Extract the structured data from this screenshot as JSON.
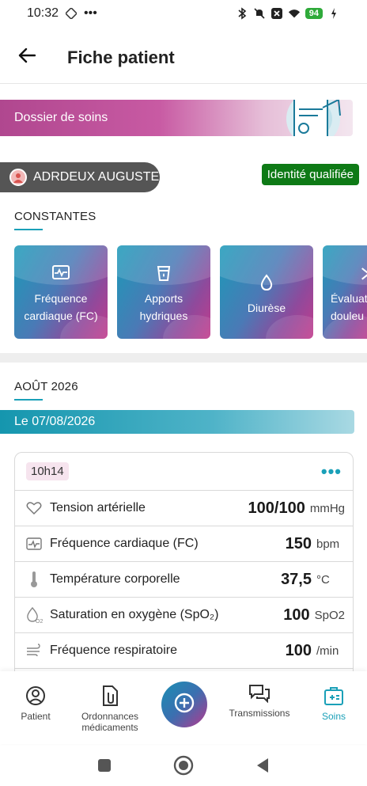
{
  "status_bar": {
    "time": "10:32",
    "extra": "•••",
    "battery": "94"
  },
  "header": {
    "title": "Fiche patient"
  },
  "banner": {
    "label": "Dossier de soins"
  },
  "patient": {
    "name": "ADRDEUX AUGUSTE",
    "identity_badge": "Identité qualifiée"
  },
  "constantes": {
    "title": "CONSTANTES",
    "cards": [
      {
        "label": "Fréquence cardiaque (FC)",
        "icon": "heart-rate-icon"
      },
      {
        "label": "Apports hydriques",
        "icon": "water-glass-icon"
      },
      {
        "label": "Diurèse",
        "icon": "drop-icon"
      },
      {
        "label": "Évaluat douleu",
        "icon": "pain-icon"
      }
    ]
  },
  "month": {
    "title": "AOÛT 2026"
  },
  "date_bar": {
    "label": "Le 07/08/2026"
  },
  "record": {
    "time": "10h14",
    "rows": [
      {
        "label": "Tension artérielle",
        "value": "100/100",
        "unit": "mmHg",
        "icon": "heart-icon"
      },
      {
        "label": "Fréquence cardiaque (FC)",
        "value": "150",
        "unit": "bpm",
        "icon": "heart-rate-icon"
      },
      {
        "label": "Température corporelle",
        "value": "37,5",
        "unit": "°C",
        "icon": "thermometer-icon"
      },
      {
        "label": "Saturation en oxygène (SpO₂)",
        "value": "100",
        "unit": "SpO2",
        "icon": "oxygen-drop-icon"
      },
      {
        "label": "Fréquence respiratoire",
        "value": "100",
        "unit": "/min",
        "icon": "wind-icon"
      }
    ]
  },
  "bottom_nav": {
    "items": [
      {
        "label": "Patient",
        "icon": "person-icon"
      },
      {
        "label": "Ordonnances médicaments",
        "icon": "prescription-icon"
      },
      {
        "label": "Transmissions",
        "icon": "chat-icon"
      },
      {
        "label": "Soins",
        "icon": "medical-kit-icon",
        "active": true
      }
    ]
  },
  "colors": {
    "accent": "#1aa0b8",
    "magenta": "#b5388e",
    "badge_green": "#0e7a16"
  }
}
